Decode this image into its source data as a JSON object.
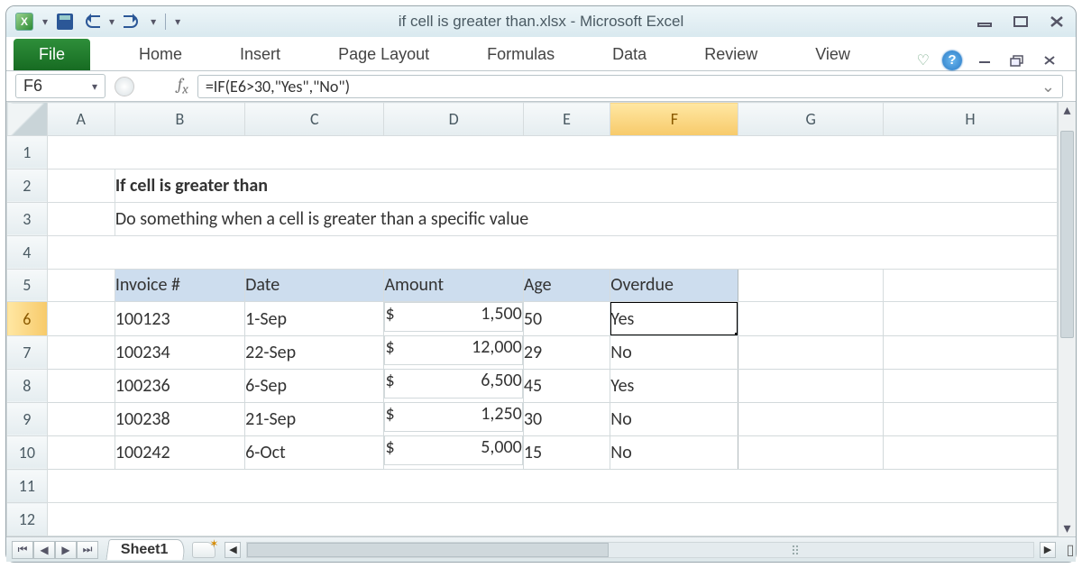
{
  "app": {
    "title": "if cell is greater than.xlsx  -  Microsoft Excel"
  },
  "ribbon": {
    "file": "File",
    "tabs": [
      "Home",
      "Insert",
      "Page Layout",
      "Formulas",
      "Data",
      "Review",
      "View"
    ]
  },
  "namebox": "F6",
  "formula": "=IF(E6>30,\"Yes\",\"No\")",
  "columns": [
    "A",
    "B",
    "C",
    "D",
    "E",
    "F",
    "G",
    "H"
  ],
  "rows": [
    "1",
    "2",
    "3",
    "4",
    "5",
    "6",
    "7",
    "8",
    "9",
    "10",
    "11",
    "12"
  ],
  "selected": {
    "col": "F",
    "row": "6"
  },
  "content": {
    "title": "If cell is greater than",
    "subtitle": "Do something when a cell is greater than a specific value",
    "headers": [
      "Invoice #",
      "Date",
      "Amount",
      "Age",
      "Overdue"
    ],
    "data": [
      {
        "invoice": "100123",
        "date": "1-Sep",
        "amount": "1,500",
        "age": "50",
        "overdue": "Yes"
      },
      {
        "invoice": "100234",
        "date": "22-Sep",
        "amount": "12,000",
        "age": "29",
        "overdue": "No"
      },
      {
        "invoice": "100236",
        "date": "6-Sep",
        "amount": "6,500",
        "age": "45",
        "overdue": "Yes"
      },
      {
        "invoice": "100238",
        "date": "21-Sep",
        "amount": "1,250",
        "age": "30",
        "overdue": "No"
      },
      {
        "invoice": "100242",
        "date": "6-Oct",
        "amount": "5,000",
        "age": "15",
        "overdue": "No"
      }
    ],
    "currency": "$"
  },
  "sheet_tab": "Sheet1"
}
